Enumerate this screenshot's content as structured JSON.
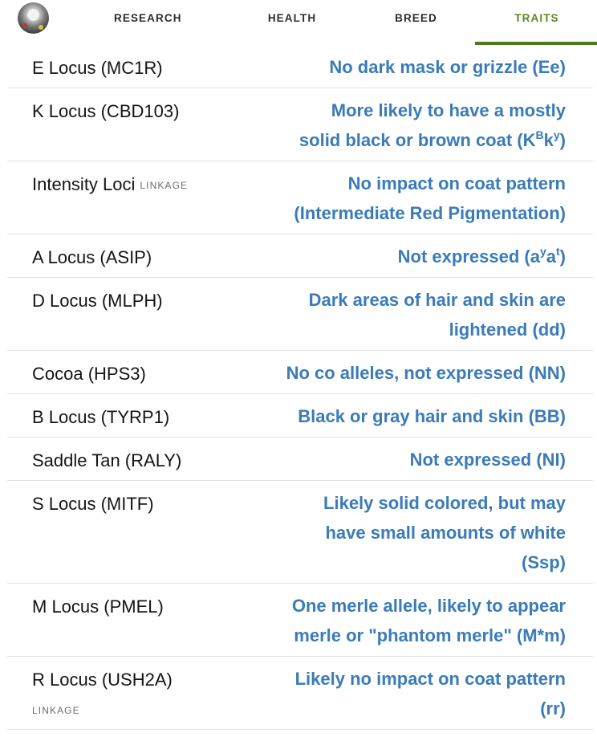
{
  "nav": {
    "tabs": [
      {
        "label": "RESEARCH",
        "active": false
      },
      {
        "label": "HEALTH",
        "active": false
      },
      {
        "label": "BREED",
        "active": false
      },
      {
        "label": "TRAITS",
        "active": true
      }
    ],
    "active_color": "#5a8a1e"
  },
  "colors": {
    "value_text": "#3a7bb8",
    "label_text": "#141414",
    "tag_text": "#6c6c6c",
    "active_tab_underline": "#4c7a1f"
  },
  "traits": [
    {
      "label": "E Locus (MC1R)",
      "value_lines": [
        "No dark mask or grizzle (Ee)"
      ]
    },
    {
      "label": "K Locus (CBD103)",
      "value_line1": "More likely to have a mostly",
      "value_line2_pre": "solid black or brown coat (K",
      "value_line2_sup1": "B",
      "value_line2_mid": "k",
      "value_line2_sup2": "y",
      "value_line2_post": ")"
    },
    {
      "label": "Intensity Loci",
      "tag": "LINKAGE",
      "value_lines": [
        "No impact on coat pattern",
        "(Intermediate Red Pigmentation)"
      ]
    },
    {
      "label": "A Locus (ASIP)",
      "value_pre": "Not expressed (a",
      "value_sup1": "y",
      "value_mid": "a",
      "value_sup2": "t",
      "value_post": ")"
    },
    {
      "label": "D Locus (MLPH)",
      "value_lines": [
        "Dark areas of hair and skin are",
        "lightened (dd)"
      ]
    },
    {
      "label": "Cocoa (HPS3)",
      "value_lines": [
        "No co alleles, not expressed (NN)"
      ]
    },
    {
      "label": "B Locus (TYRP1)",
      "value_lines": [
        "Black or gray hair and skin (BB)"
      ]
    },
    {
      "label": "Saddle Tan (RALY)",
      "value_lines": [
        "Not expressed (NI)"
      ]
    },
    {
      "label": "S Locus (MITF)",
      "value_lines": [
        "Likely solid colored, but may",
        "have small amounts of white",
        "(Ssp)"
      ]
    },
    {
      "label": "M Locus (PMEL)",
      "value_lines": [
        "One merle allele, likely to appear",
        "merle or \"phantom merle\" (M*m)"
      ]
    },
    {
      "label": "R Locus (USH2A)",
      "tag": "LINKAGE",
      "value_lines": [
        "Likely no impact on coat pattern",
        "(rr)"
      ]
    }
  ]
}
